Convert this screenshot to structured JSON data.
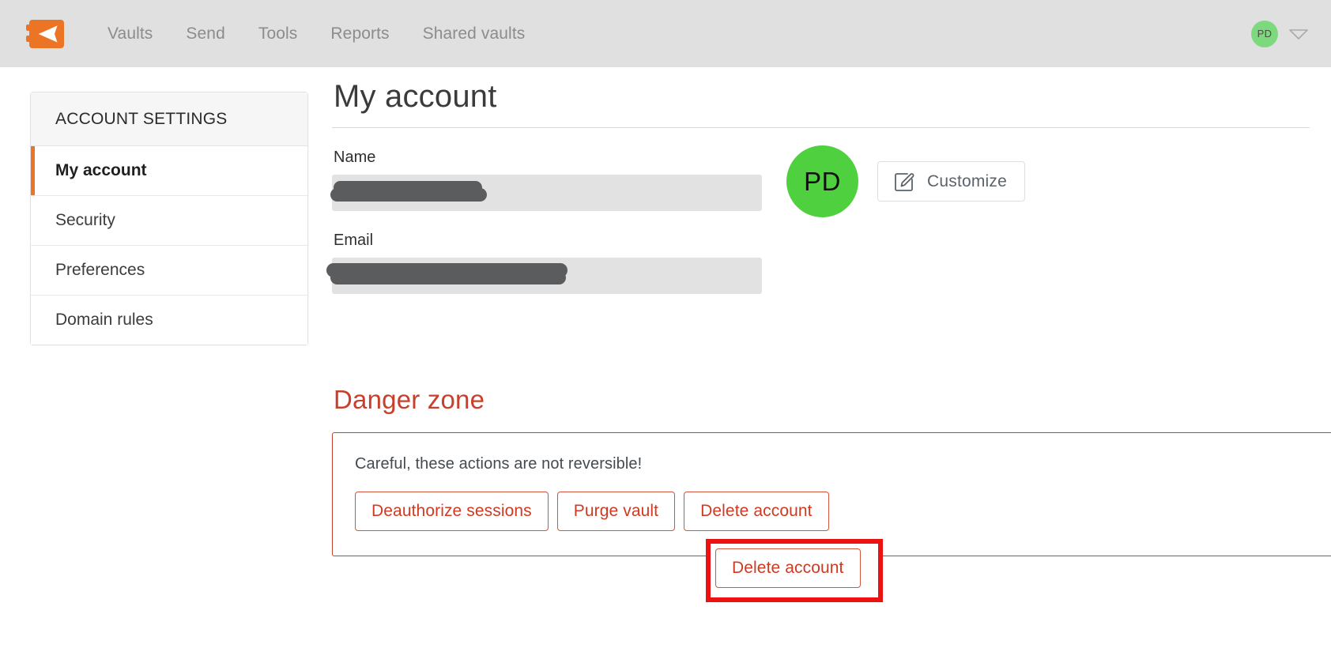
{
  "topbar": {
    "logo_icon": "passbolt-logo-icon",
    "nav_items": [
      {
        "label": "Vaults"
      },
      {
        "label": "Send"
      },
      {
        "label": "Tools"
      },
      {
        "label": "Reports"
      },
      {
        "label": "Shared vaults"
      }
    ],
    "avatar_initials": "PD",
    "caret_icon": "chevron-down-icon",
    "background_color": "#e0e0e0",
    "avatar_color": "#7ed97e"
  },
  "sidebar": {
    "title": "ACCOUNT SETTINGS",
    "active_accent_color": "#e8752a",
    "items": [
      {
        "label": "My account",
        "active": true
      },
      {
        "label": "Security",
        "active": false
      },
      {
        "label": "Preferences",
        "active": false
      },
      {
        "label": "Domain rules",
        "active": false
      }
    ]
  },
  "main": {
    "page_title": "My account",
    "fields": [
      {
        "label": "Name",
        "value": "",
        "redacted": true
      },
      {
        "label": "Email",
        "value": "",
        "redacted": true
      }
    ],
    "profile": {
      "avatar_initials": "PD",
      "avatar_color": "#4fd13f",
      "customize_label": "Customize",
      "customize_icon": "edit-pencil-square-icon"
    }
  },
  "danger_zone": {
    "title": "Danger zone",
    "title_color": "#c8402c",
    "note": "Careful, these actions are not reversible!",
    "buttons": [
      {
        "label": "Deauthorize sessions"
      },
      {
        "label": "Purge vault"
      },
      {
        "label": "Delete account"
      }
    ],
    "highlight": {
      "target": "Delete account",
      "color": "#ee1111"
    }
  }
}
